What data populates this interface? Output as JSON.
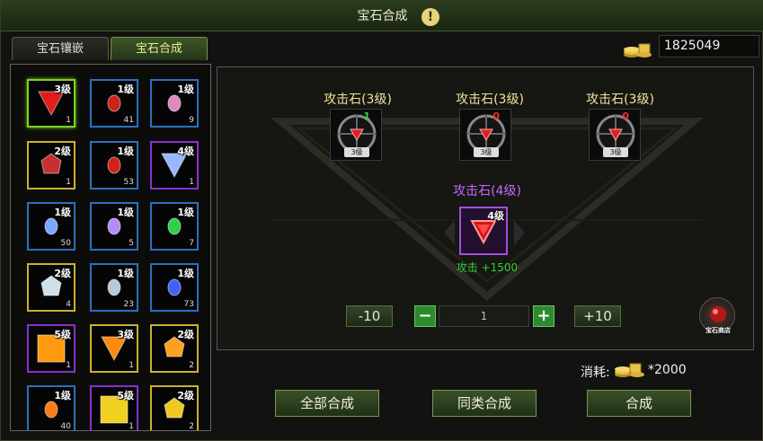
{
  "window": {
    "title": "宝石合成"
  },
  "tabs": [
    {
      "label": "宝石镶嵌"
    },
    {
      "label": "宝石合成"
    }
  ],
  "currency": {
    "gold": "1825049"
  },
  "gem_slots": [
    {
      "level": "3级",
      "count": "1",
      "gem": "red-triangle-gem",
      "frame": "selected"
    },
    {
      "level": "1级",
      "count": "41",
      "gem": "red-orb-gem",
      "frame": "blue"
    },
    {
      "level": "1级",
      "count": "9",
      "gem": "pink-gem",
      "frame": "blue"
    },
    {
      "level": "2级",
      "count": "1",
      "gem": "red-crystal-gem",
      "frame": "yellow"
    },
    {
      "level": "1级",
      "count": "53",
      "gem": "red-orb-gem",
      "frame": "blue"
    },
    {
      "level": "4级",
      "count": "1",
      "gem": "blue-triangle-gem",
      "frame": "purple"
    },
    {
      "level": "1级",
      "count": "50",
      "gem": "blue-gem",
      "frame": "blue"
    },
    {
      "level": "1级",
      "count": "5",
      "gem": "violet-gem",
      "frame": "blue"
    },
    {
      "level": "1级",
      "count": "7",
      "gem": "green-gem",
      "frame": "blue"
    },
    {
      "level": "2级",
      "count": "4",
      "gem": "white-crystal-gem",
      "frame": "yellow"
    },
    {
      "level": "1级",
      "count": "23",
      "gem": "white-gem",
      "frame": "blue"
    },
    {
      "level": "1级",
      "count": "73",
      "gem": "indigo-gem",
      "frame": "blue"
    },
    {
      "level": "5级",
      "count": "1",
      "gem": "orange-square-gem",
      "frame": "purple"
    },
    {
      "level": "3级",
      "count": "1",
      "gem": "orange-triangle-gem",
      "frame": "yellow"
    },
    {
      "level": "2级",
      "count": "2",
      "gem": "orange-crystal-gem",
      "frame": "yellow"
    },
    {
      "level": "1级",
      "count": "40",
      "gem": "orange-gem",
      "frame": "blue"
    },
    {
      "level": "5级",
      "count": "1",
      "gem": "yellow-square-gem",
      "frame": "purple"
    },
    {
      "level": "2级",
      "count": "2",
      "gem": "yellow-crystal-gem",
      "frame": "yellow"
    }
  ],
  "ingredients": [
    {
      "name": "攻击石(3级)",
      "badge": "3级",
      "count": "1",
      "count_color": "#33dd33"
    },
    {
      "name": "攻击石(3级)",
      "badge": "3级",
      "count": "0",
      "count_color": "#ee3030"
    },
    {
      "name": "攻击石(3级)",
      "badge": "3级",
      "count": "0",
      "count_color": "#ee3030"
    }
  ],
  "result": {
    "name": "攻击石(4级)",
    "level": "4级",
    "stat": "攻击 +1500"
  },
  "quantity": {
    "minus10": "-10",
    "minus": "−",
    "value": "1",
    "plus": "+",
    "plus10": "+10"
  },
  "shop": {
    "label": "宝石商店"
  },
  "cost": {
    "label": "消耗:",
    "value": "*2000"
  },
  "actions": {
    "all": "全部合成",
    "same": "同类合成",
    "combine": "合成"
  },
  "colors": {
    "frame_blue": "#2c6fbf",
    "frame_yellow": "#c9b030",
    "frame_purple": "#8a2fd0",
    "frame_selected": "#7ed321",
    "accent_green": "#33d033"
  }
}
